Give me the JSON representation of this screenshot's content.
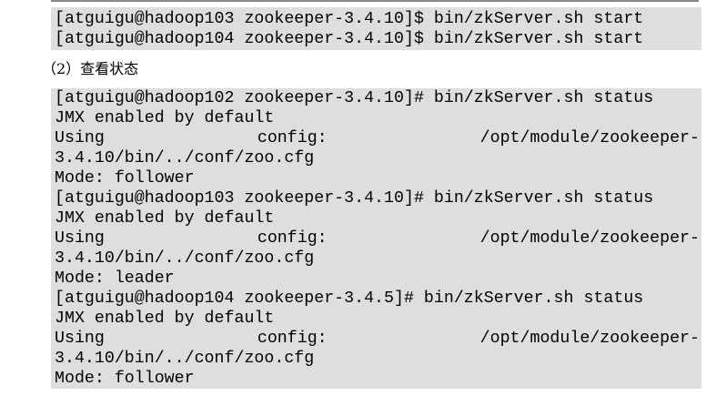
{
  "start_block": {
    "lines": [
      "[atguigu@hadoop103 zookeeper-3.4.10]$ bin/zkServer.sh start",
      "[atguigu@hadoop104 zookeeper-3.4.10]$ bin/zkServer.sh start"
    ]
  },
  "section_heading": "（2）查看状态",
  "status_block": {
    "lines": [
      "[atguigu@hadoop102 zookeeper-3.4.10]# bin/zkServer.sh status",
      "JMX enabled by default",
      {
        "a": "Using",
        "b": "config:",
        "c": "/opt/module/zookeeper-"
      },
      "3.4.10/bin/../conf/zoo.cfg",
      "Mode: follower",
      "[atguigu@hadoop103 zookeeper-3.4.10]# bin/zkServer.sh status",
      "JMX enabled by default",
      {
        "a": "Using",
        "b": "config:",
        "c": "/opt/module/zookeeper-"
      },
      "3.4.10/bin/../conf/zoo.cfg",
      "Mode: leader",
      "[atguigu@hadoop104 zookeeper-3.4.5]# bin/zkServer.sh status",
      "JMX enabled by default",
      {
        "a": "Using",
        "b": "config:",
        "c": "/opt/module/zookeeper-"
      },
      "3.4.10/bin/../conf/zoo.cfg",
      "Mode: follower"
    ]
  }
}
